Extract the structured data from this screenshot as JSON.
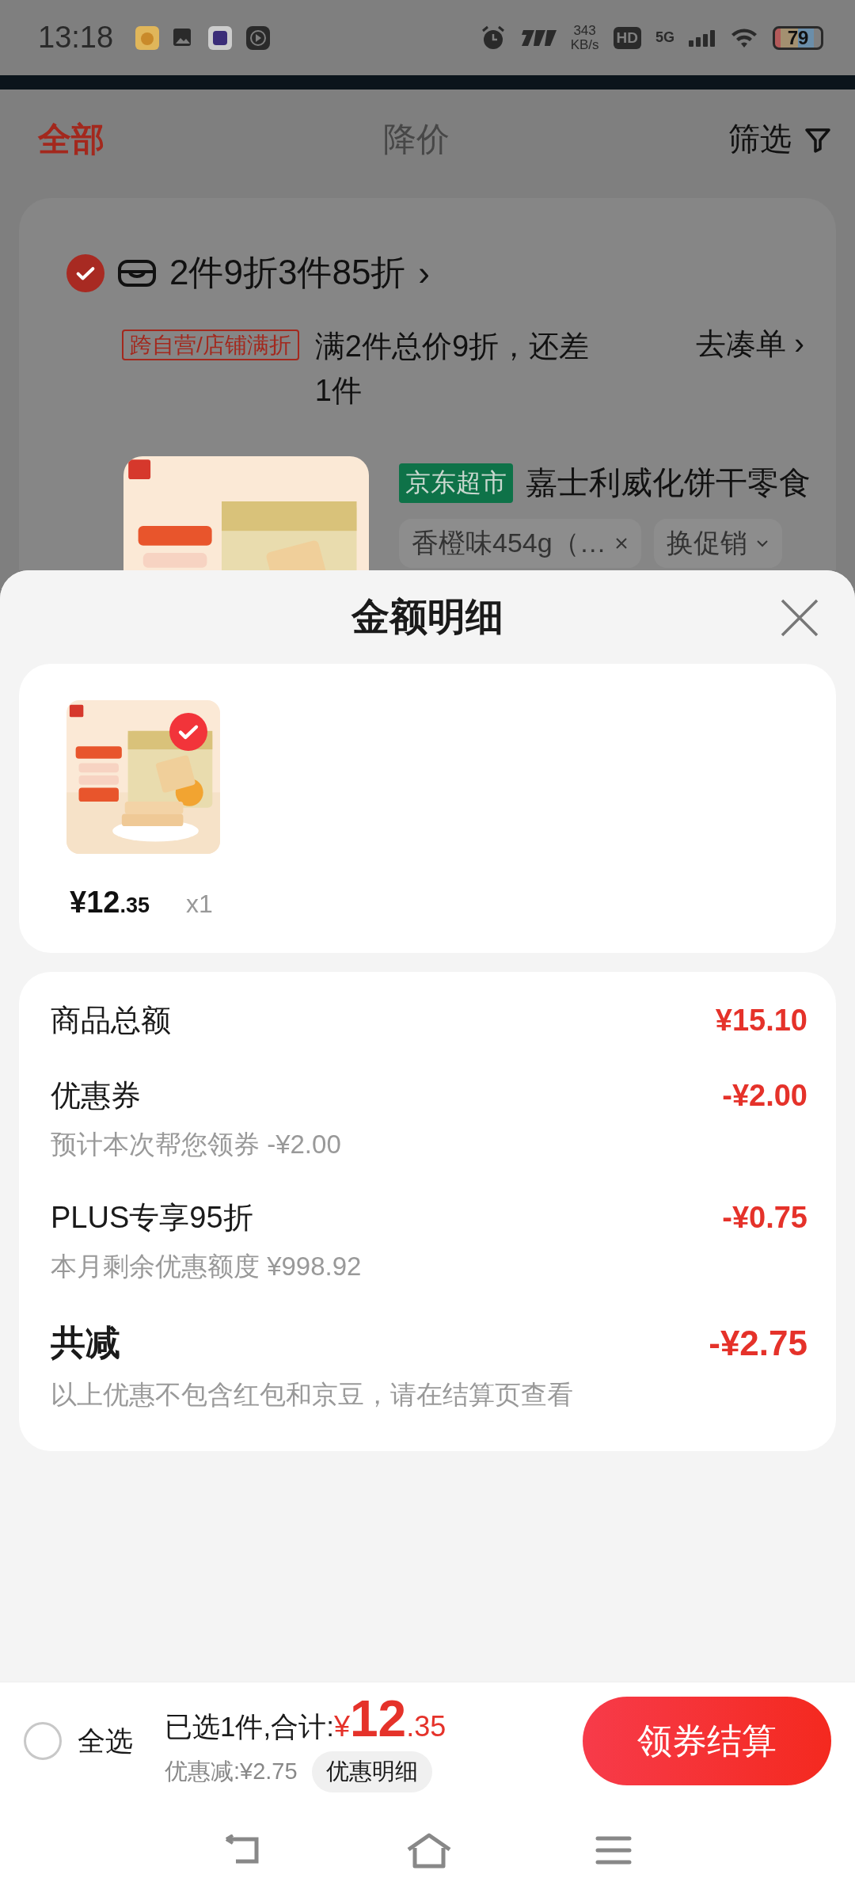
{
  "status_bar": {
    "time": "13:18",
    "net_speed_value": "343",
    "net_speed_unit": "KB/s",
    "hd": "HD",
    "network": "5G",
    "battery": "79"
  },
  "tabs": [
    {
      "label": "全部",
      "selected": true
    },
    {
      "label": "降价",
      "selected": false
    }
  ],
  "filter": {
    "label": "筛选"
  },
  "store_group": {
    "checked": true,
    "promo_title": "2件9折3件85折",
    "promo_arrow": "›",
    "promo_tag": "跨自营/店铺满折",
    "promo_text": "满2件总价9折，还差1件",
    "add_on": "去凑单",
    "add_on_arrow": "›",
    "product": {
      "badge": "京东超市",
      "title": "嘉士利威化饼干零食",
      "spec": "香橙味454g（…",
      "promo_switch": "换促销"
    }
  },
  "sheet": {
    "title": "金额明细",
    "items": [
      {
        "checked": true,
        "price_main": "¥12",
        "price_decimal": ".35",
        "quantity": "x1"
      }
    ],
    "rows": [
      {
        "kind": "total",
        "label": "商品总额",
        "amount": "¥15.10"
      },
      {
        "kind": "discount",
        "label": "优惠券",
        "amount": "-¥2.00",
        "note": "预计本次帮您领券 -¥2.00"
      },
      {
        "kind": "discount",
        "label": "PLUS专享95折",
        "amount": "-¥0.75",
        "note": "本月剩余优惠额度 ¥998.92"
      },
      {
        "kind": "sum",
        "label": "共减",
        "amount": "-¥2.75",
        "note": "以上优惠不包含红包和京豆，请在结算页查看"
      }
    ]
  },
  "footer": {
    "select_all": {
      "label": "全选",
      "checked": false
    },
    "selected_text": "已选1件,合计:",
    "currency": "¥",
    "total_main": "12",
    "total_decimal": ".35",
    "saving": "优惠减:¥2.75",
    "detail_button": "优惠明细",
    "checkout": "领券结算"
  }
}
